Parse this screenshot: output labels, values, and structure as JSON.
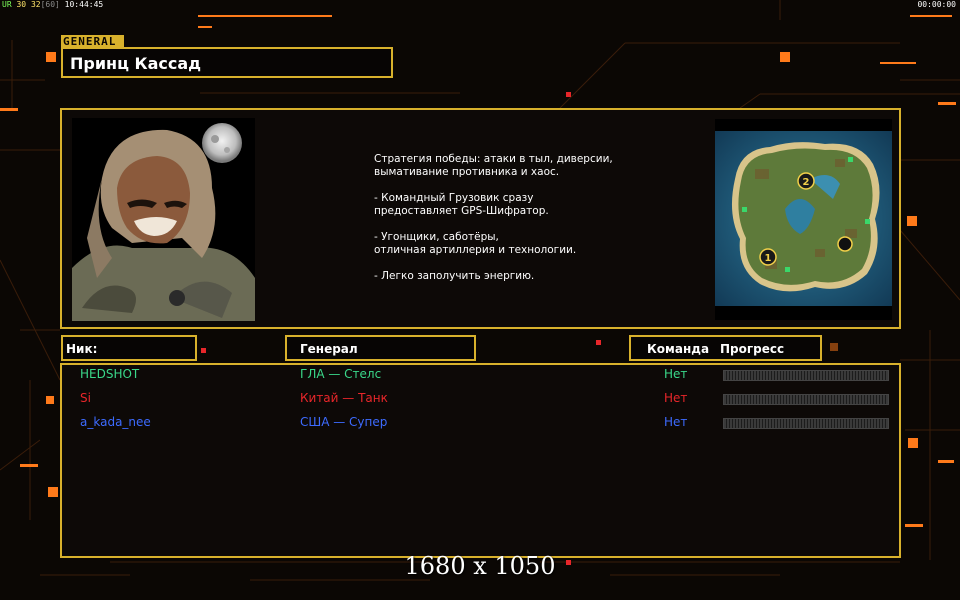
{
  "hud": {
    "stat_a": "UR",
    "stat_b": "30",
    "stat_c": "32",
    "stat_d": "[60]",
    "clock": "10:44:45",
    "timer": "00:00:00"
  },
  "general_tag": "GENERAL",
  "general_name": "Принц Кассад",
  "description": "Стратегия победы: атаки в тыл, диверсии,\n вымативание противника и хаос.\n\n- Командный Грузовик сразу\nпредоставляет GPS-Шифратор.\n\n- Угонщики, саботёры,\nотличная артиллерия и технологии.\n\n- Легко заполучить энергию.",
  "headers": {
    "nick": "Ник:",
    "general": "Генерал",
    "team": "Команда",
    "progress": "Прогресс"
  },
  "minimap": {
    "marker_1": "1",
    "marker_2": "2"
  },
  "players": [
    {
      "nick": "HEDSHOT",
      "general": "ГЛА — Стелс",
      "team": "Нет",
      "color": "#3ad88a",
      "progress": 0
    },
    {
      "nick": "Si",
      "general": "Китай — Танк",
      "team": "Нет",
      "color": "#e8262a",
      "progress": 0
    },
    {
      "nick": "a_kada_nee",
      "general": "США — Супер",
      "team": "Нет",
      "color": "#3d6bff",
      "progress": 0
    }
  ],
  "resolution_label": "1680 x 1050",
  "colors": {
    "frame": "#d8b12c",
    "accent": "#ff7a1a"
  }
}
